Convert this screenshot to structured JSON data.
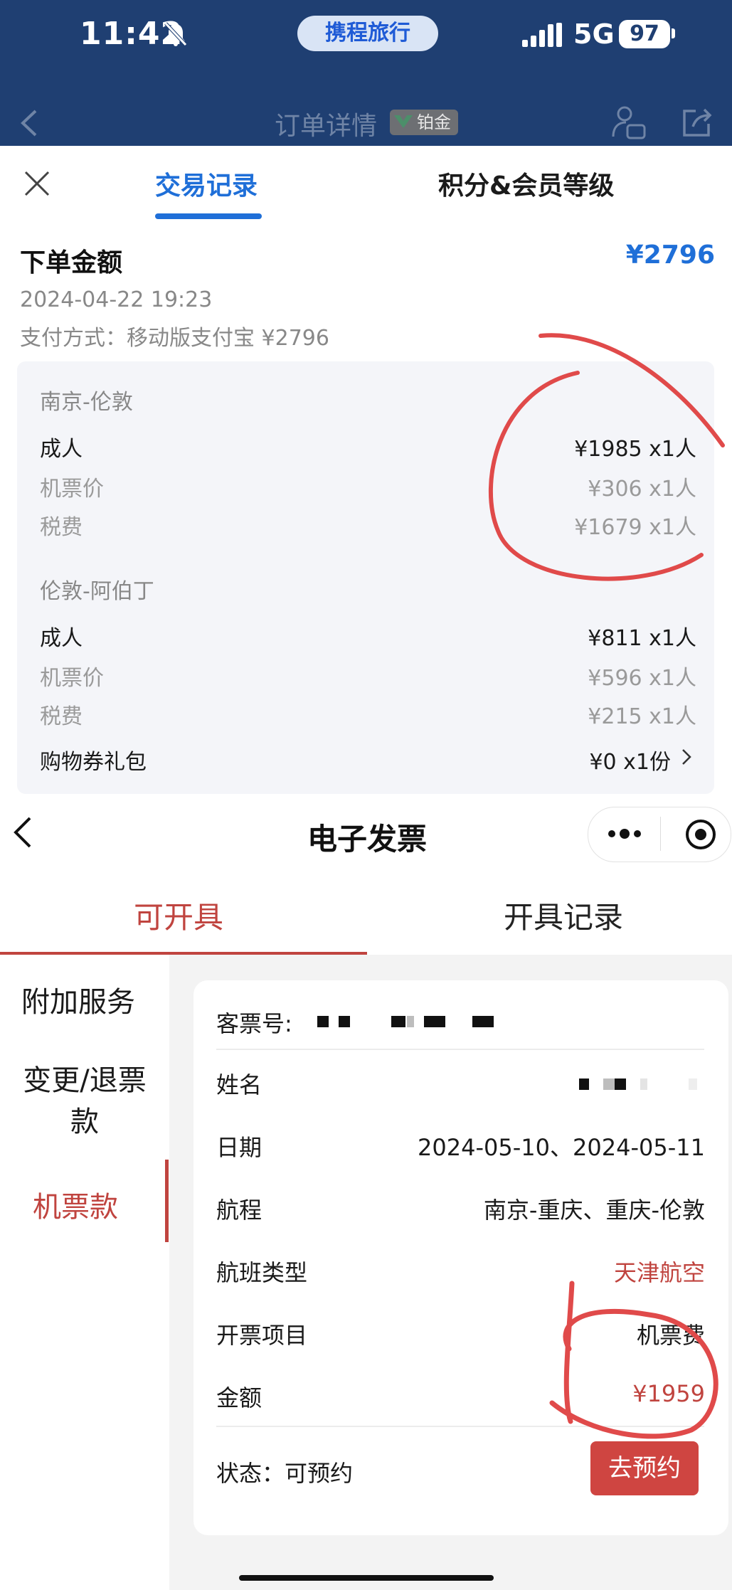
{
  "status_bar": {
    "time": "11:42",
    "center_brand": "携程旅行",
    "network": "5G",
    "battery": "97"
  },
  "order_nav": {
    "title": "订单详情",
    "vip_label": "铂金"
  },
  "sheet": {
    "tabs": [
      {
        "label": "交易记录",
        "active": true
      },
      {
        "label": "积分&会员等级",
        "active": false
      }
    ],
    "order_label": "下单金额",
    "order_amount": "¥2796",
    "order_date": "2024-04-22 19:23",
    "payment": "支付方式：移动版支付宝 ¥2796",
    "segments": [
      {
        "route": "南京-伦敦",
        "rows": [
          {
            "label": "成人",
            "value": "¥1985 x1人"
          },
          {
            "label": "机票价",
            "value": "¥306 x1人"
          },
          {
            "label": "税费",
            "value": "¥1679 x1人"
          }
        ]
      },
      {
        "route": "伦敦-阿伯丁",
        "rows": [
          {
            "label": "成人",
            "value": "¥811 x1人"
          },
          {
            "label": "机票价",
            "value": "¥596 x1人"
          },
          {
            "label": "税费",
            "value": "¥215 x1人"
          }
        ]
      }
    ],
    "coupon": {
      "label": "购物券礼包",
      "value": "¥0 x1份"
    }
  },
  "invoice_app": {
    "title": "电子发票",
    "tabs": [
      {
        "label": "可开具",
        "active": true
      },
      {
        "label": "开具记录",
        "active": false
      }
    ],
    "sidebar": [
      "附加服务",
      "变更/退票款",
      "机票款"
    ],
    "card": {
      "ticket_no_label": "客票号:",
      "name_label": "姓名",
      "date_label": "日期",
      "date_value": "2024-05-10、2024-05-11",
      "route_label": "航程",
      "route_value": "南京-重庆、重庆-伦敦",
      "flight_type_label": "航班类型",
      "flight_type_value": "天津航空",
      "item_label": "开票项目",
      "item_value": "机票费",
      "amount_label": "金额",
      "amount_value": "¥1959",
      "status": "状态：可预约",
      "book_button": "去预约"
    }
  },
  "colors": {
    "status_bar_bg": "#1f3f72",
    "ctrip_blue": "#1f6fd8",
    "invoice_red": "#c0443f",
    "annotation_red": "#e04a4a"
  }
}
